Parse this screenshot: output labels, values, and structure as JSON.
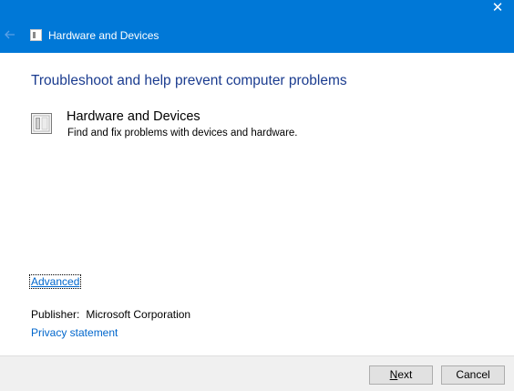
{
  "window": {
    "title": "Hardware and Devices",
    "close_glyph": "✕",
    "back_icon": "back-arrow-icon",
    "title_icon": "hardware-devices-icon",
    "accent_color": "#0078d7"
  },
  "main": {
    "heading": "Troubleshoot and help prevent computer problems",
    "item": {
      "icon": "hardware-devices-icon",
      "title": "Hardware and Devices",
      "description": "Find and fix problems with devices and hardware."
    },
    "advanced_link": "Advanced",
    "publisher_label": "Publisher:",
    "publisher_value": "Microsoft Corporation",
    "privacy_link": "Privacy statement"
  },
  "footer": {
    "next_accel": "N",
    "next_rest": "ext",
    "cancel_label": "Cancel"
  }
}
